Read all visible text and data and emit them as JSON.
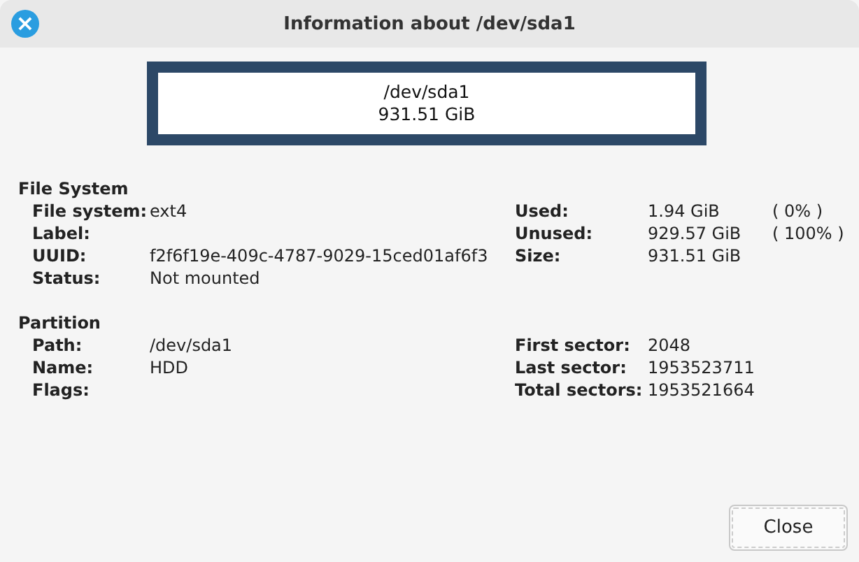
{
  "window": {
    "title": "Information about /dev/sda1",
    "close_button": "×"
  },
  "partition_graphic": {
    "path": "/dev/sda1",
    "size": "931.51 GiB"
  },
  "sections": [
    {
      "title": "File System",
      "left": [
        {
          "label": "File system:",
          "value": "ext4"
        },
        {
          "label": "Label:"
        },
        {
          "label": "UUID:",
          "value": "f2f6f19e-409c-4787-9029-15ced01af6f3"
        },
        {
          "label": "Status:",
          "value": "Not mounted"
        }
      ],
      "right": [
        {
          "label": "Used:",
          "value": "1.94 GiB",
          "percent": "( 0% )"
        },
        {
          "label": "Unused:",
          "value": "929.57 GiB",
          "percent": "( 100% )"
        },
        {
          "label": "Size:",
          "value": "931.51 GiB"
        }
      ]
    },
    {
      "title": "Partition",
      "left": [
        {
          "label": "Path:",
          "value": "/dev/sda1"
        },
        {
          "label": "Name:",
          "value": "HDD"
        },
        {
          "label": "Flags:"
        }
      ],
      "right": [
        {
          "label": "First sector:",
          "value": "2048"
        },
        {
          "label": "Last sector:",
          "value": "1953523711"
        },
        {
          "label": "Total sectors:",
          "value": "1953521664"
        }
      ]
    }
  ],
  "buttons": [
    "Close"
  ]
}
